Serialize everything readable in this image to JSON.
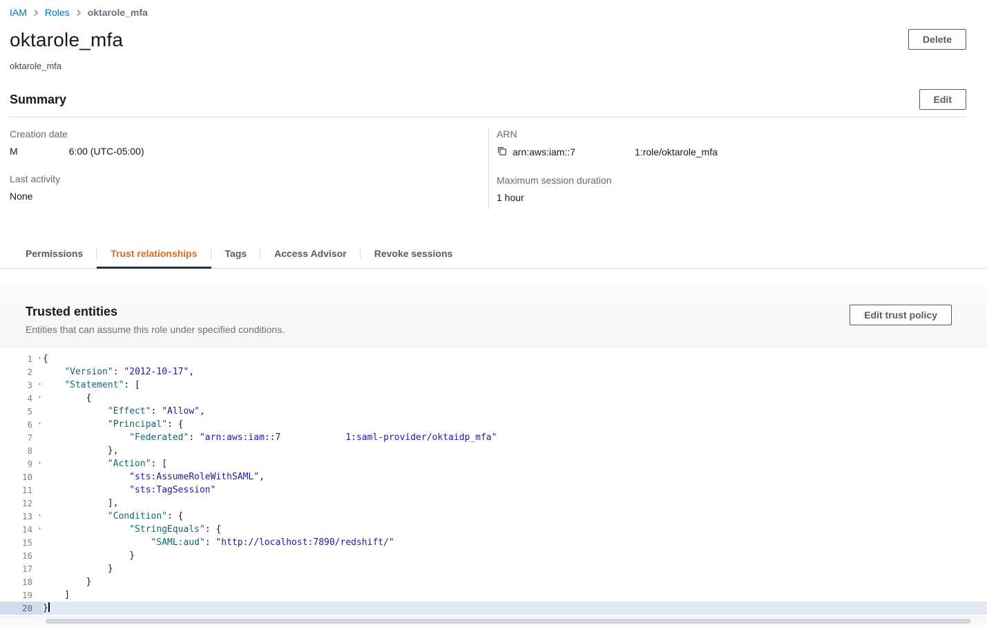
{
  "colors": {
    "link": "#0073bb",
    "active_tab_text": "#dd6b10",
    "active_tab_underline": "#232f3e",
    "button_border": "#545b64",
    "editor_key": "#0f6674",
    "editor_string": "#1a1aa6",
    "active_line_bg": "#e4e9f4"
  },
  "breadcrumb": {
    "items": [
      {
        "label": "IAM",
        "link": true
      },
      {
        "label": "Roles",
        "link": true
      },
      {
        "label": "oktarole_mfa",
        "link": false
      }
    ]
  },
  "header": {
    "title": "oktarole_mfa",
    "subtitle": "oktarole_mfa",
    "delete_label": "Delete"
  },
  "summary": {
    "heading": "Summary",
    "edit_label": "Edit",
    "creation_date_label": "Creation date",
    "creation_date_prefix": "M",
    "creation_date_value": "6:00 (UTC-05:00)",
    "last_activity_label": "Last activity",
    "last_activity_value": "None",
    "arn_label": "ARN",
    "arn_prefix": "arn:aws:iam::7",
    "arn_suffix": "1:role/oktarole_mfa",
    "max_session_label": "Maximum session duration",
    "max_session_value": "1 hour"
  },
  "tabs": [
    {
      "label": "Permissions",
      "active": false
    },
    {
      "label": "Trust relationships",
      "active": true
    },
    {
      "label": "Tags",
      "active": false
    },
    {
      "label": "Access Advisor",
      "active": false
    },
    {
      "label": "Revoke sessions",
      "active": false
    }
  ],
  "trusted": {
    "heading": "Trusted entities",
    "subtitle": "Entities that can assume this role under specified conditions.",
    "edit_button": "Edit trust policy"
  },
  "editor": {
    "language": "json",
    "fold_glyph": "▾",
    "lines": [
      {
        "n": 1,
        "fold": true,
        "tokens": [
          [
            "p",
            "{"
          ]
        ]
      },
      {
        "n": 2,
        "tokens": [
          [
            "p",
            "    "
          ],
          [
            "k",
            "\"Version\""
          ],
          [
            "p",
            ": "
          ],
          [
            "s",
            "\"2012-10-17\""
          ],
          [
            "p",
            ","
          ]
        ]
      },
      {
        "n": 3,
        "fold": true,
        "tokens": [
          [
            "p",
            "    "
          ],
          [
            "k",
            "\"Statement\""
          ],
          [
            "p",
            ": ["
          ]
        ]
      },
      {
        "n": 4,
        "fold": true,
        "tokens": [
          [
            "p",
            "        {"
          ]
        ]
      },
      {
        "n": 5,
        "tokens": [
          [
            "p",
            "            "
          ],
          [
            "k",
            "\"Effect\""
          ],
          [
            "p",
            ": "
          ],
          [
            "s",
            "\"Allow\""
          ],
          [
            "p",
            ","
          ]
        ]
      },
      {
        "n": 6,
        "fold": true,
        "tokens": [
          [
            "p",
            "            "
          ],
          [
            "k",
            "\"Principal\""
          ],
          [
            "p",
            ": {"
          ]
        ]
      },
      {
        "n": 7,
        "tokens": [
          [
            "p",
            "                "
          ],
          [
            "k",
            "\"Federated\""
          ],
          [
            "p",
            ": "
          ],
          [
            "s",
            "\"arn:aws:iam::7"
          ],
          [
            "r",
            "            "
          ],
          [
            "s",
            "1:saml-provider/oktaidp_mfa\""
          ]
        ]
      },
      {
        "n": 8,
        "tokens": [
          [
            "p",
            "            },"
          ]
        ]
      },
      {
        "n": 9,
        "fold": true,
        "tokens": [
          [
            "p",
            "            "
          ],
          [
            "k",
            "\"Action\""
          ],
          [
            "p",
            ": ["
          ]
        ]
      },
      {
        "n": 10,
        "tokens": [
          [
            "p",
            "                "
          ],
          [
            "s",
            "\"sts:AssumeRoleWithSAML\""
          ],
          [
            "p",
            ","
          ]
        ]
      },
      {
        "n": 11,
        "tokens": [
          [
            "p",
            "                "
          ],
          [
            "s",
            "\"sts:TagSession\""
          ]
        ]
      },
      {
        "n": 12,
        "tokens": [
          [
            "p",
            "            ],"
          ]
        ]
      },
      {
        "n": 13,
        "fold": true,
        "tokens": [
          [
            "p",
            "            "
          ],
          [
            "k",
            "\"Condition\""
          ],
          [
            "p",
            ": {"
          ]
        ]
      },
      {
        "n": 14,
        "fold": true,
        "tokens": [
          [
            "p",
            "                "
          ],
          [
            "k",
            "\"StringEquals\""
          ],
          [
            "p",
            ": {"
          ]
        ]
      },
      {
        "n": 15,
        "tokens": [
          [
            "p",
            "                    "
          ],
          [
            "k",
            "\"SAML:aud\""
          ],
          [
            "p",
            ": "
          ],
          [
            "s",
            "\"http://localhost:7890/redshift/\""
          ]
        ]
      },
      {
        "n": 16,
        "tokens": [
          [
            "p",
            "                }"
          ]
        ]
      },
      {
        "n": 17,
        "tokens": [
          [
            "p",
            "            }"
          ]
        ]
      },
      {
        "n": 18,
        "tokens": [
          [
            "p",
            "        }"
          ]
        ]
      },
      {
        "n": 19,
        "tokens": [
          [
            "p",
            "    ]"
          ]
        ]
      },
      {
        "n": 20,
        "active": true,
        "cursor": true,
        "tokens": [
          [
            "p",
            "}"
          ]
        ]
      }
    ]
  }
}
